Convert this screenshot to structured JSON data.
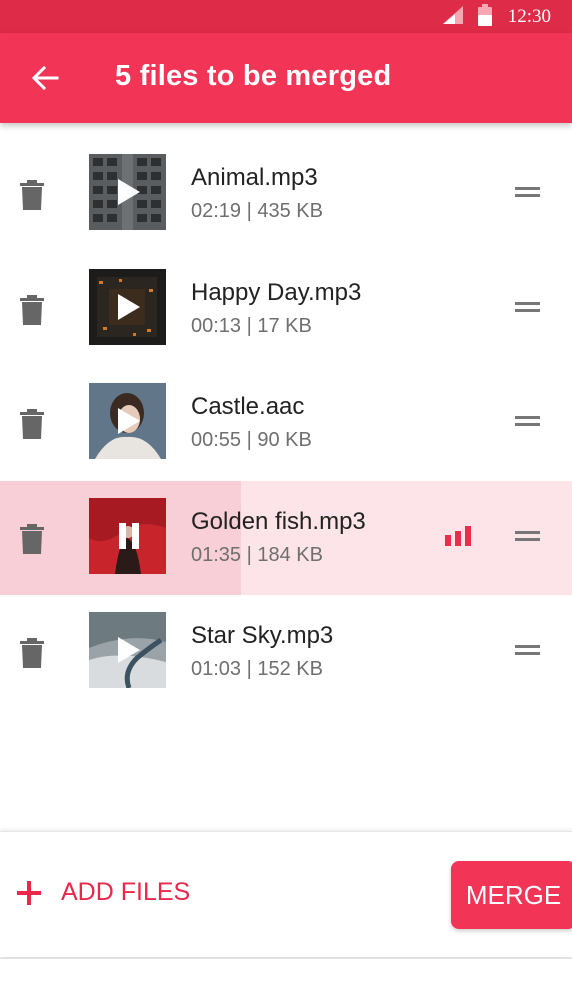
{
  "status_bar": {
    "time": "12:30"
  },
  "app_bar": {
    "title": "5 files to be merged"
  },
  "tracks": [
    {
      "name": "Animal.mp3",
      "meta": "02:19 | 435 KB"
    },
    {
      "name": "Happy Day.mp3",
      "meta": "00:13 | 17 KB"
    },
    {
      "name": "Castle.aac",
      "meta": "00:55 | 90 KB"
    },
    {
      "name": "Golden fish.mp3",
      "meta": "01:35 | 184 KB",
      "playing": true
    },
    {
      "name": "Star Sky.mp3",
      "meta": "01:03 | 152 KB"
    }
  ],
  "bottom_bar": {
    "add_label": "ADD FILES",
    "merge_label": "MERGE"
  },
  "colors": {
    "accent": "#f23456",
    "status_bar": "#dd2b48",
    "playing_row": "#fce4e8"
  }
}
